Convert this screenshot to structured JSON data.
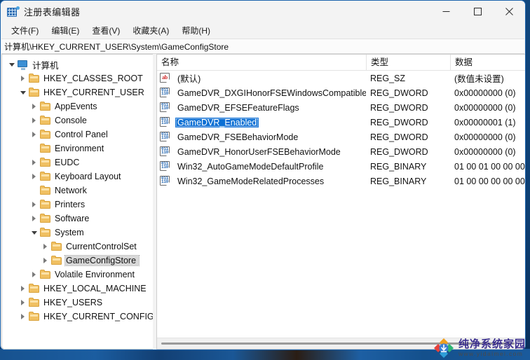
{
  "window": {
    "title": "注册表编辑器",
    "app_icon": "registry-editor-icon",
    "minimize_label": "—",
    "maximize_label": "□",
    "close_label": "✕"
  },
  "menubar": {
    "items": [
      {
        "label": "文件(F)",
        "name": "menu-file"
      },
      {
        "label": "编辑(E)",
        "name": "menu-edit"
      },
      {
        "label": "查看(V)",
        "name": "menu-view"
      },
      {
        "label": "收藏夹(A)",
        "name": "menu-favorites"
      },
      {
        "label": "帮助(H)",
        "name": "menu-help"
      }
    ]
  },
  "address": {
    "path": "计算机\\HKEY_CURRENT_USER\\System\\GameConfigStore"
  },
  "tree": {
    "nodes": [
      {
        "label": "计算机",
        "indent": 0,
        "twist": "down",
        "icon": "computer-icon",
        "selected": false
      },
      {
        "label": "HKEY_CLASSES_ROOT",
        "indent": 1,
        "twist": "right",
        "icon": "folder-icon",
        "selected": false
      },
      {
        "label": "HKEY_CURRENT_USER",
        "indent": 1,
        "twist": "down",
        "icon": "folder-icon",
        "selected": false
      },
      {
        "label": "AppEvents",
        "indent": 2,
        "twist": "right",
        "icon": "folder-icon",
        "selected": false
      },
      {
        "label": "Console",
        "indent": 2,
        "twist": "right",
        "icon": "folder-icon",
        "selected": false
      },
      {
        "label": "Control Panel",
        "indent": 2,
        "twist": "right",
        "icon": "folder-icon",
        "selected": false
      },
      {
        "label": "Environment",
        "indent": 2,
        "twist": "none",
        "icon": "folder-icon",
        "selected": false
      },
      {
        "label": "EUDC",
        "indent": 2,
        "twist": "right",
        "icon": "folder-icon",
        "selected": false
      },
      {
        "label": "Keyboard Layout",
        "indent": 2,
        "twist": "right",
        "icon": "folder-icon",
        "selected": false
      },
      {
        "label": "Network",
        "indent": 2,
        "twist": "none",
        "icon": "folder-icon",
        "selected": false
      },
      {
        "label": "Printers",
        "indent": 2,
        "twist": "right",
        "icon": "folder-icon",
        "selected": false
      },
      {
        "label": "Software",
        "indent": 2,
        "twist": "right",
        "icon": "folder-icon",
        "selected": false
      },
      {
        "label": "System",
        "indent": 2,
        "twist": "down",
        "icon": "folder-icon",
        "selected": false
      },
      {
        "label": "CurrentControlSet",
        "indent": 3,
        "twist": "right",
        "icon": "folder-icon",
        "selected": false
      },
      {
        "label": "GameConfigStore",
        "indent": 3,
        "twist": "right",
        "icon": "folder-icon",
        "selected": true
      },
      {
        "label": "Volatile Environment",
        "indent": 2,
        "twist": "right",
        "icon": "folder-icon",
        "selected": false
      },
      {
        "label": "HKEY_LOCAL_MACHINE",
        "indent": 1,
        "twist": "right",
        "icon": "folder-icon",
        "selected": false
      },
      {
        "label": "HKEY_USERS",
        "indent": 1,
        "twist": "right",
        "icon": "folder-icon",
        "selected": false
      },
      {
        "label": "HKEY_CURRENT_CONFIG",
        "indent": 1,
        "twist": "right",
        "icon": "folder-icon",
        "selected": false
      }
    ]
  },
  "list": {
    "columns": [
      {
        "label": "名称",
        "name": "column-name"
      },
      {
        "label": "类型",
        "name": "column-type"
      },
      {
        "label": "数据",
        "name": "column-data"
      }
    ],
    "rows": [
      {
        "icon": "string-value-icon",
        "icon_glyph": "ab",
        "name": "(默认)",
        "type": "REG_SZ",
        "data": "(数值未设置)",
        "selected": false
      },
      {
        "icon": "dword-value-icon",
        "icon_glyph": "011\n110",
        "name": "GameDVR_DXGIHonorFSEWindowsCompatible",
        "type": "REG_DWORD",
        "data": "0x00000000 (0)",
        "selected": false
      },
      {
        "icon": "dword-value-icon",
        "icon_glyph": "011\n110",
        "name": "GameDVR_EFSEFeatureFlags",
        "type": "REG_DWORD",
        "data": "0x00000000 (0)",
        "selected": false
      },
      {
        "icon": "dword-value-icon",
        "icon_glyph": "011\n110",
        "name": "GameDVR_Enabled",
        "type": "REG_DWORD",
        "data": "0x00000001 (1)",
        "selected": true
      },
      {
        "icon": "dword-value-icon",
        "icon_glyph": "011\n110",
        "name": "GameDVR_FSEBehaviorMode",
        "type": "REG_DWORD",
        "data": "0x00000000 (0)",
        "selected": false
      },
      {
        "icon": "dword-value-icon",
        "icon_glyph": "011\n110",
        "name": "GameDVR_HonorUserFSEBehaviorMode",
        "type": "REG_DWORD",
        "data": "0x00000000 (0)",
        "selected": false
      },
      {
        "icon": "binary-value-icon",
        "icon_glyph": "011\n110",
        "name": "Win32_AutoGameModeDefaultProfile",
        "type": "REG_BINARY",
        "data": "01 00 01 00 00 00",
        "selected": false
      },
      {
        "icon": "binary-value-icon",
        "icon_glyph": "011\n110",
        "name": "Win32_GameModeRelatedProcesses",
        "type": "REG_BINARY",
        "data": "01 00 00 00 00 00",
        "selected": false
      }
    ]
  },
  "watermark": {
    "title": "纯净系统家园",
    "url": "www.yidaimei.com"
  },
  "colors": {
    "selection_blue": "#0b6fd4",
    "tree_selection_gray": "#d8d8d8",
    "window_border": "#1d64ad",
    "folder_yellow": "#f0c062",
    "watermark_purple": "#3b2f8f"
  }
}
